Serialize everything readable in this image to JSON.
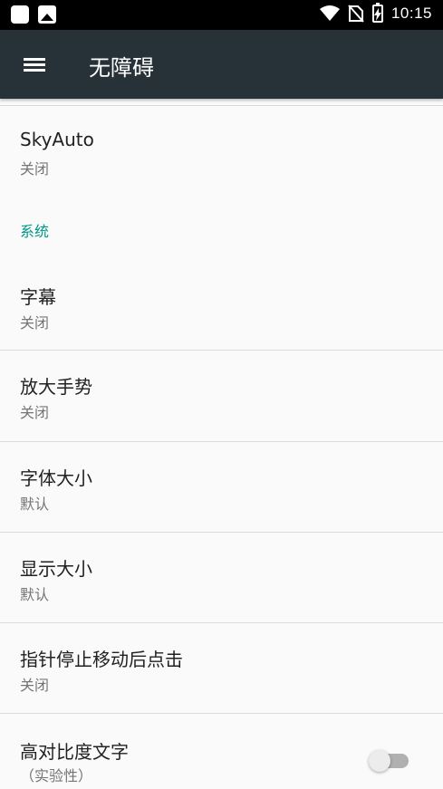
{
  "status_bar": {
    "time": "10:15"
  },
  "app_bar": {
    "title": "无障碍"
  },
  "items": [
    {
      "title": "SkyAuto",
      "summary": "关闭"
    },
    {
      "title": "字幕",
      "summary": "关闭"
    },
    {
      "title": "放大手势",
      "summary": "关闭"
    },
    {
      "title": "字体大小",
      "summary": "默认"
    },
    {
      "title": "显示大小",
      "summary": "默认"
    },
    {
      "title": "指针停止移动后点击",
      "summary": "关闭"
    },
    {
      "title": "高对比度文字",
      "summary": "（实验性）",
      "switch_on": false
    }
  ],
  "categories": {
    "system": "系统"
  },
  "colors": {
    "app_bar": "#263238",
    "accent": "#009688",
    "background": "#fafafa"
  }
}
